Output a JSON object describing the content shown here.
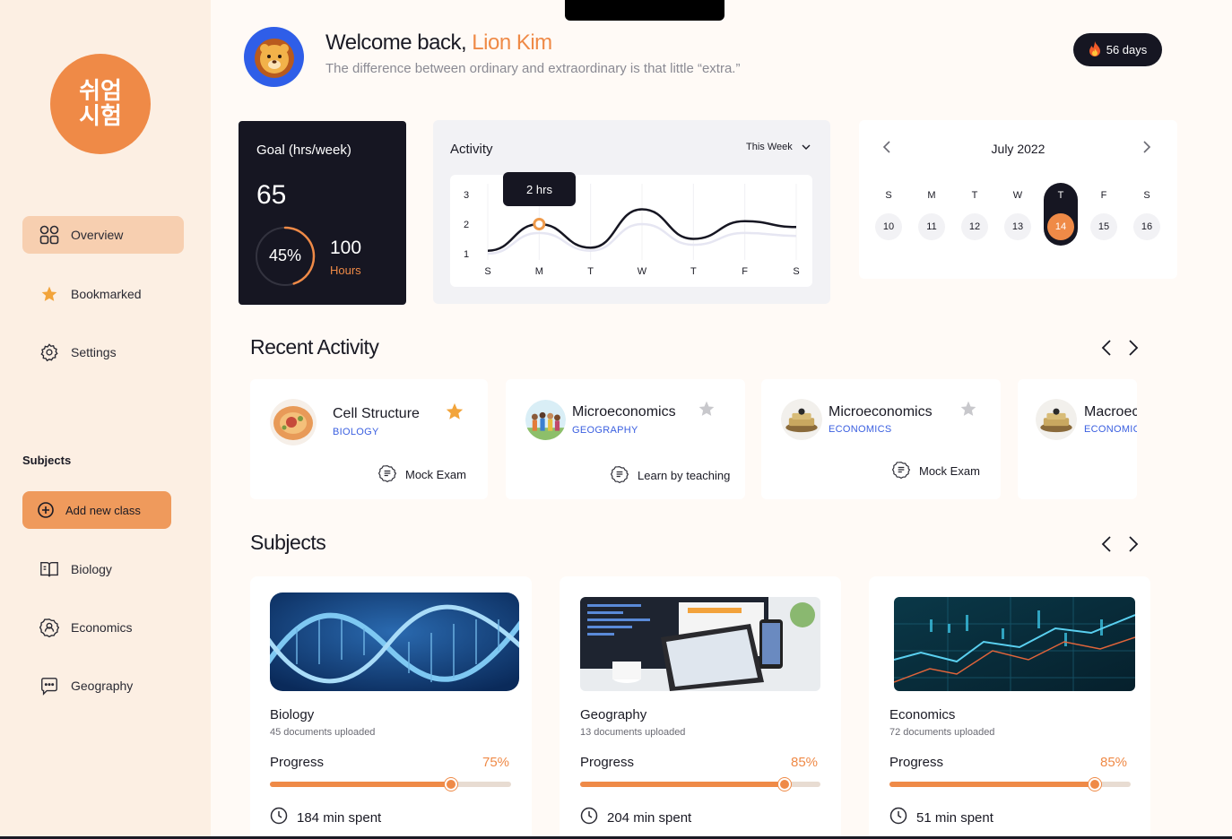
{
  "sidebar": {
    "logo_line1": "쉬엄",
    "logo_line2": "시험",
    "nav": [
      {
        "label": "Overview",
        "icon": "grid-icon",
        "active": true
      },
      {
        "label": "Bookmarked",
        "icon": "star-icon"
      },
      {
        "label": "Settings",
        "icon": "gear-icon"
      }
    ],
    "subjects_heading": "Subjects",
    "add_class_label": "Add new class",
    "subjects": [
      {
        "label": "Biology",
        "icon": "book-icon"
      },
      {
        "label": "Economics",
        "icon": "person-badge-icon"
      },
      {
        "label": "Geography",
        "icon": "chat-icon"
      }
    ]
  },
  "header": {
    "welcome_prefix": "Welcome back,",
    "user_name": "Lion Kim",
    "quote": "The difference between ordinary and extraordinary is that little “extra.”",
    "streak": "56 days"
  },
  "goal": {
    "title": "Goal (hrs/week)",
    "value": "65",
    "percent": "45%",
    "percent_value": 0.45,
    "hours": "100",
    "hours_label": "Hours"
  },
  "activity": {
    "title": "Activity",
    "range": "This Week",
    "tooltip": "2 hrs",
    "chart_data": {
      "type": "line",
      "categories": [
        "S",
        "M",
        "T",
        "W",
        "T",
        "F",
        "S"
      ],
      "yticks": [
        "3",
        "2",
        "1"
      ],
      "ylim": [
        0.5,
        3
      ],
      "series": [
        {
          "values": [
            1.1,
            2,
            1.2,
            2.5,
            1.5,
            2.1,
            1.9
          ],
          "color": "#161622"
        },
        {
          "values": [
            1,
            1.7,
            1.1,
            2.0,
            1.3,
            1.7,
            1.6
          ],
          "color": "#e6e6f2"
        }
      ],
      "highlight_index": 1
    }
  },
  "calendar": {
    "month": "July 2022",
    "days": [
      "S",
      "M",
      "T",
      "W",
      "T",
      "F",
      "S"
    ],
    "dates": [
      "10",
      "11",
      "12",
      "13",
      "14",
      "15",
      "16"
    ],
    "selected_index": 4
  },
  "recent": {
    "title": "Recent Activity",
    "cards": [
      {
        "name": "Cell Structure",
        "subject": "BIOLOGY",
        "starred": true,
        "type": "Mock Exam"
      },
      {
        "name": "Microeconomics",
        "subject": "GEOGRAPHY",
        "starred": false,
        "type": "Learn by teaching"
      },
      {
        "name": "Microeconomics",
        "subject": "ECONOMICS",
        "starred": false,
        "type": "Mock Exam"
      },
      {
        "name": "Macroeconomics",
        "subject": "ECONOMICS",
        "starred": false,
        "type": ""
      }
    ]
  },
  "subjects": {
    "title": "Subjects",
    "cards": [
      {
        "name": "Biology",
        "docs": "45 documents uploaded",
        "progress_label": "Progress",
        "percent": "75%",
        "progress": 0.75,
        "time": "184 min spent"
      },
      {
        "name": "Geography",
        "docs": "13 documents uploaded",
        "progress_label": "Progress",
        "percent": "85%",
        "progress": 0.85,
        "time": "204 min spent"
      },
      {
        "name": "Economics",
        "docs": "72 documents uploaded",
        "progress_label": "Progress",
        "percent": "85%",
        "progress": 0.85,
        "time": "51 min spent"
      }
    ]
  },
  "colors": {
    "accent": "#ef8a47",
    "dark": "#161622",
    "link": "#3a5fe0"
  }
}
